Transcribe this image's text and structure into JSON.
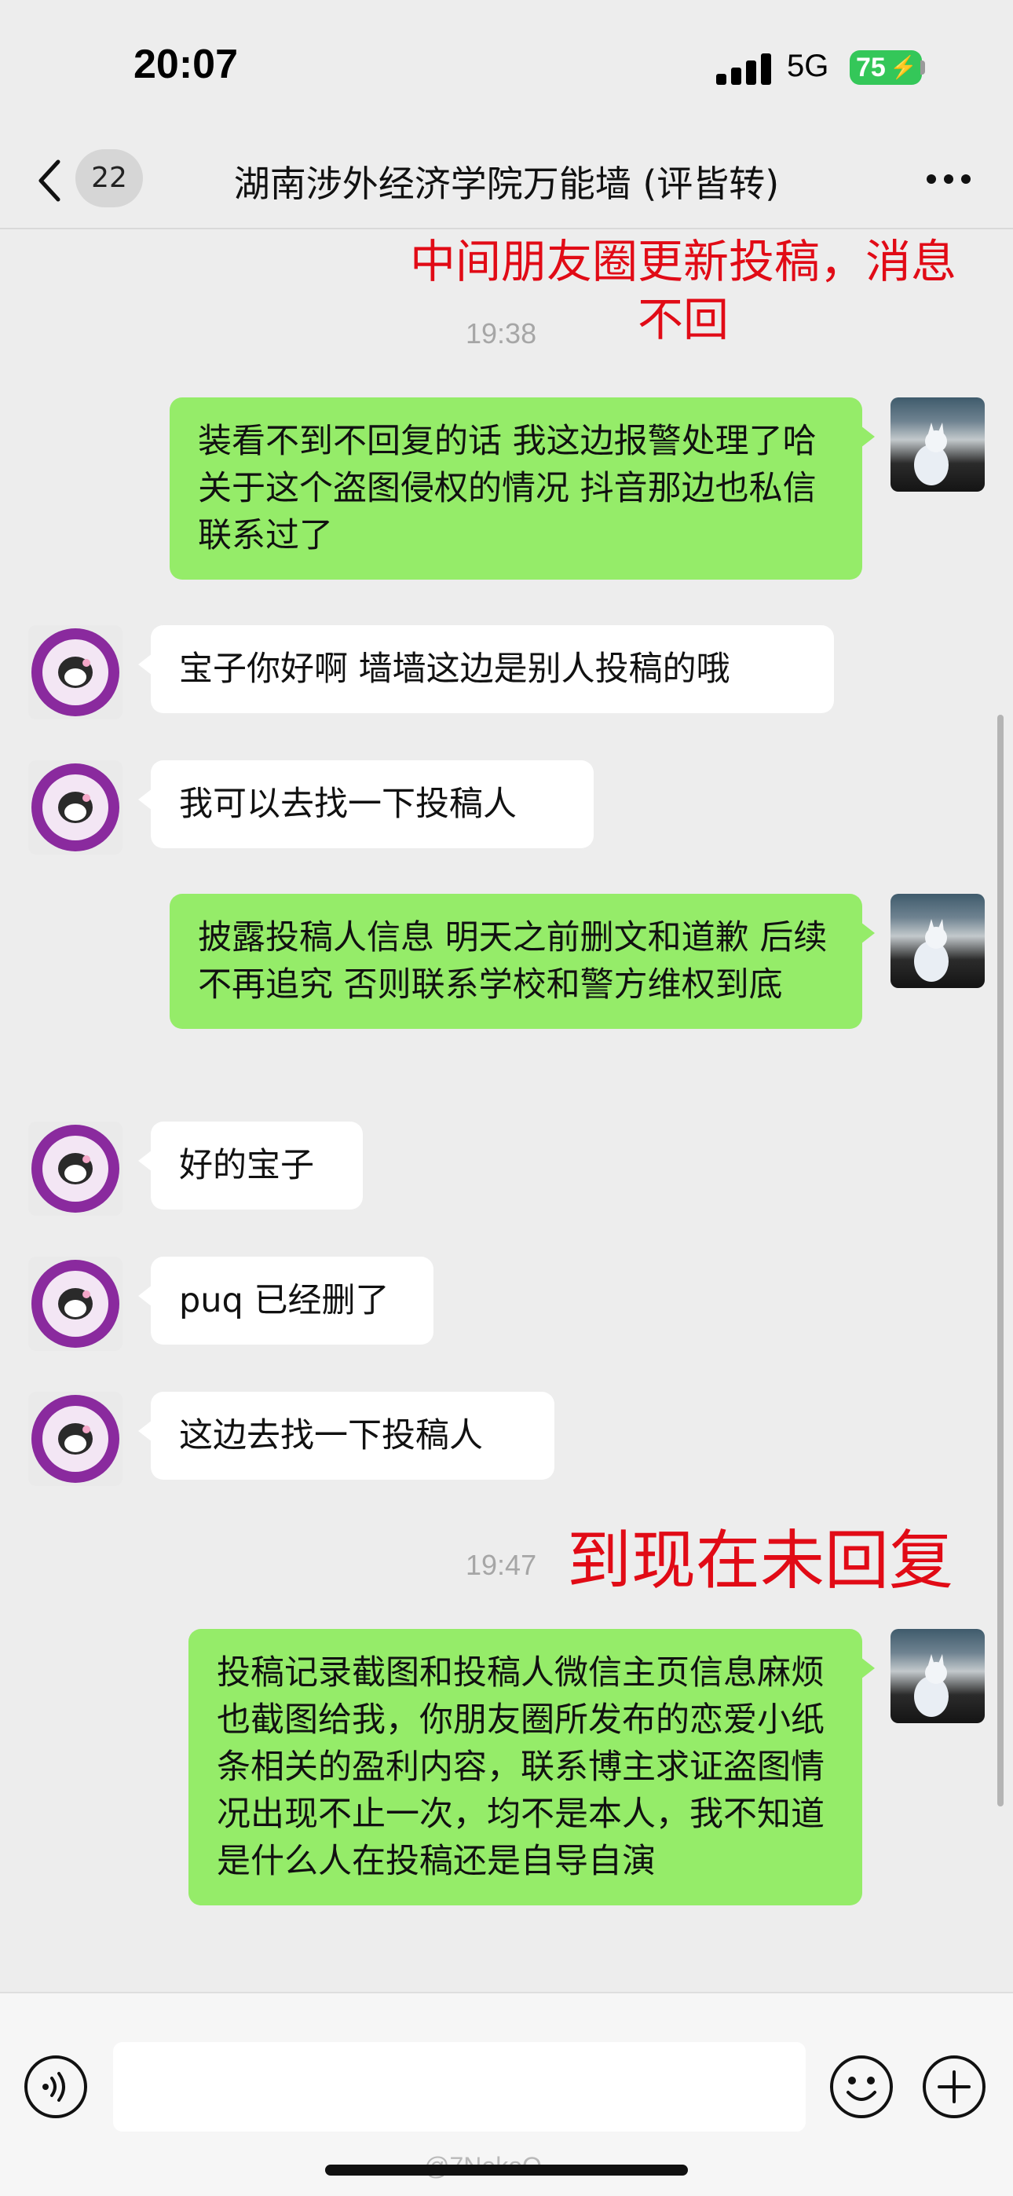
{
  "status_bar": {
    "time": "20:07",
    "network": "5G",
    "battery": "75"
  },
  "header": {
    "back_count": "22",
    "title": "湖南涉外经济学院万能墙 (评皆转)"
  },
  "annotations": {
    "top": "中间朋友圈更新投稿，消息不回",
    "bottom": "到现在未回复"
  },
  "timestamps": [
    "19:38",
    "19:47"
  ],
  "messages": [
    {
      "sender": "me",
      "text": "装看不到不回复的话 我这边报警处理了哈 关于这个盗图侵权的情况 抖音那边也私信联系过了"
    },
    {
      "sender": "other",
      "text": "宝子你好啊 墙墙这边是别人投稿的哦"
    },
    {
      "sender": "other",
      "text": "我可以去找一下投稿人"
    },
    {
      "sender": "me",
      "text": "披露投稿人信息 明天之前删文和道歉 后续不再追究 否则联系学校和警方维权到底"
    },
    {
      "sender": "other",
      "text": "好的宝子"
    },
    {
      "sender": "other",
      "text": "puq 已经删了"
    },
    {
      "sender": "other",
      "text": "这边去找一下投稿人"
    },
    {
      "sender": "me",
      "text": "投稿记录截图和投稿人微信主页信息麻烦也截图给我，你朋友圈所发布的恋爱小纸条相关的盈利内容，联系博主求证盗图情况出现不止一次，均不是本人，我不知道是什么人在投稿还是自导自演"
    }
  ],
  "input_bar": {
    "placeholder": ""
  },
  "watermark": "@7NekoO",
  "icons": {
    "back": "chevron-left-icon",
    "more": "more-dots-icon",
    "voice": "voice-icon",
    "emoji": "emoji-icon",
    "plus": "plus-icon"
  },
  "colors": {
    "my_bubble": "#95ec69",
    "other_bubble": "#ffffff",
    "background": "#ededed",
    "annotation": "#e10b16"
  }
}
